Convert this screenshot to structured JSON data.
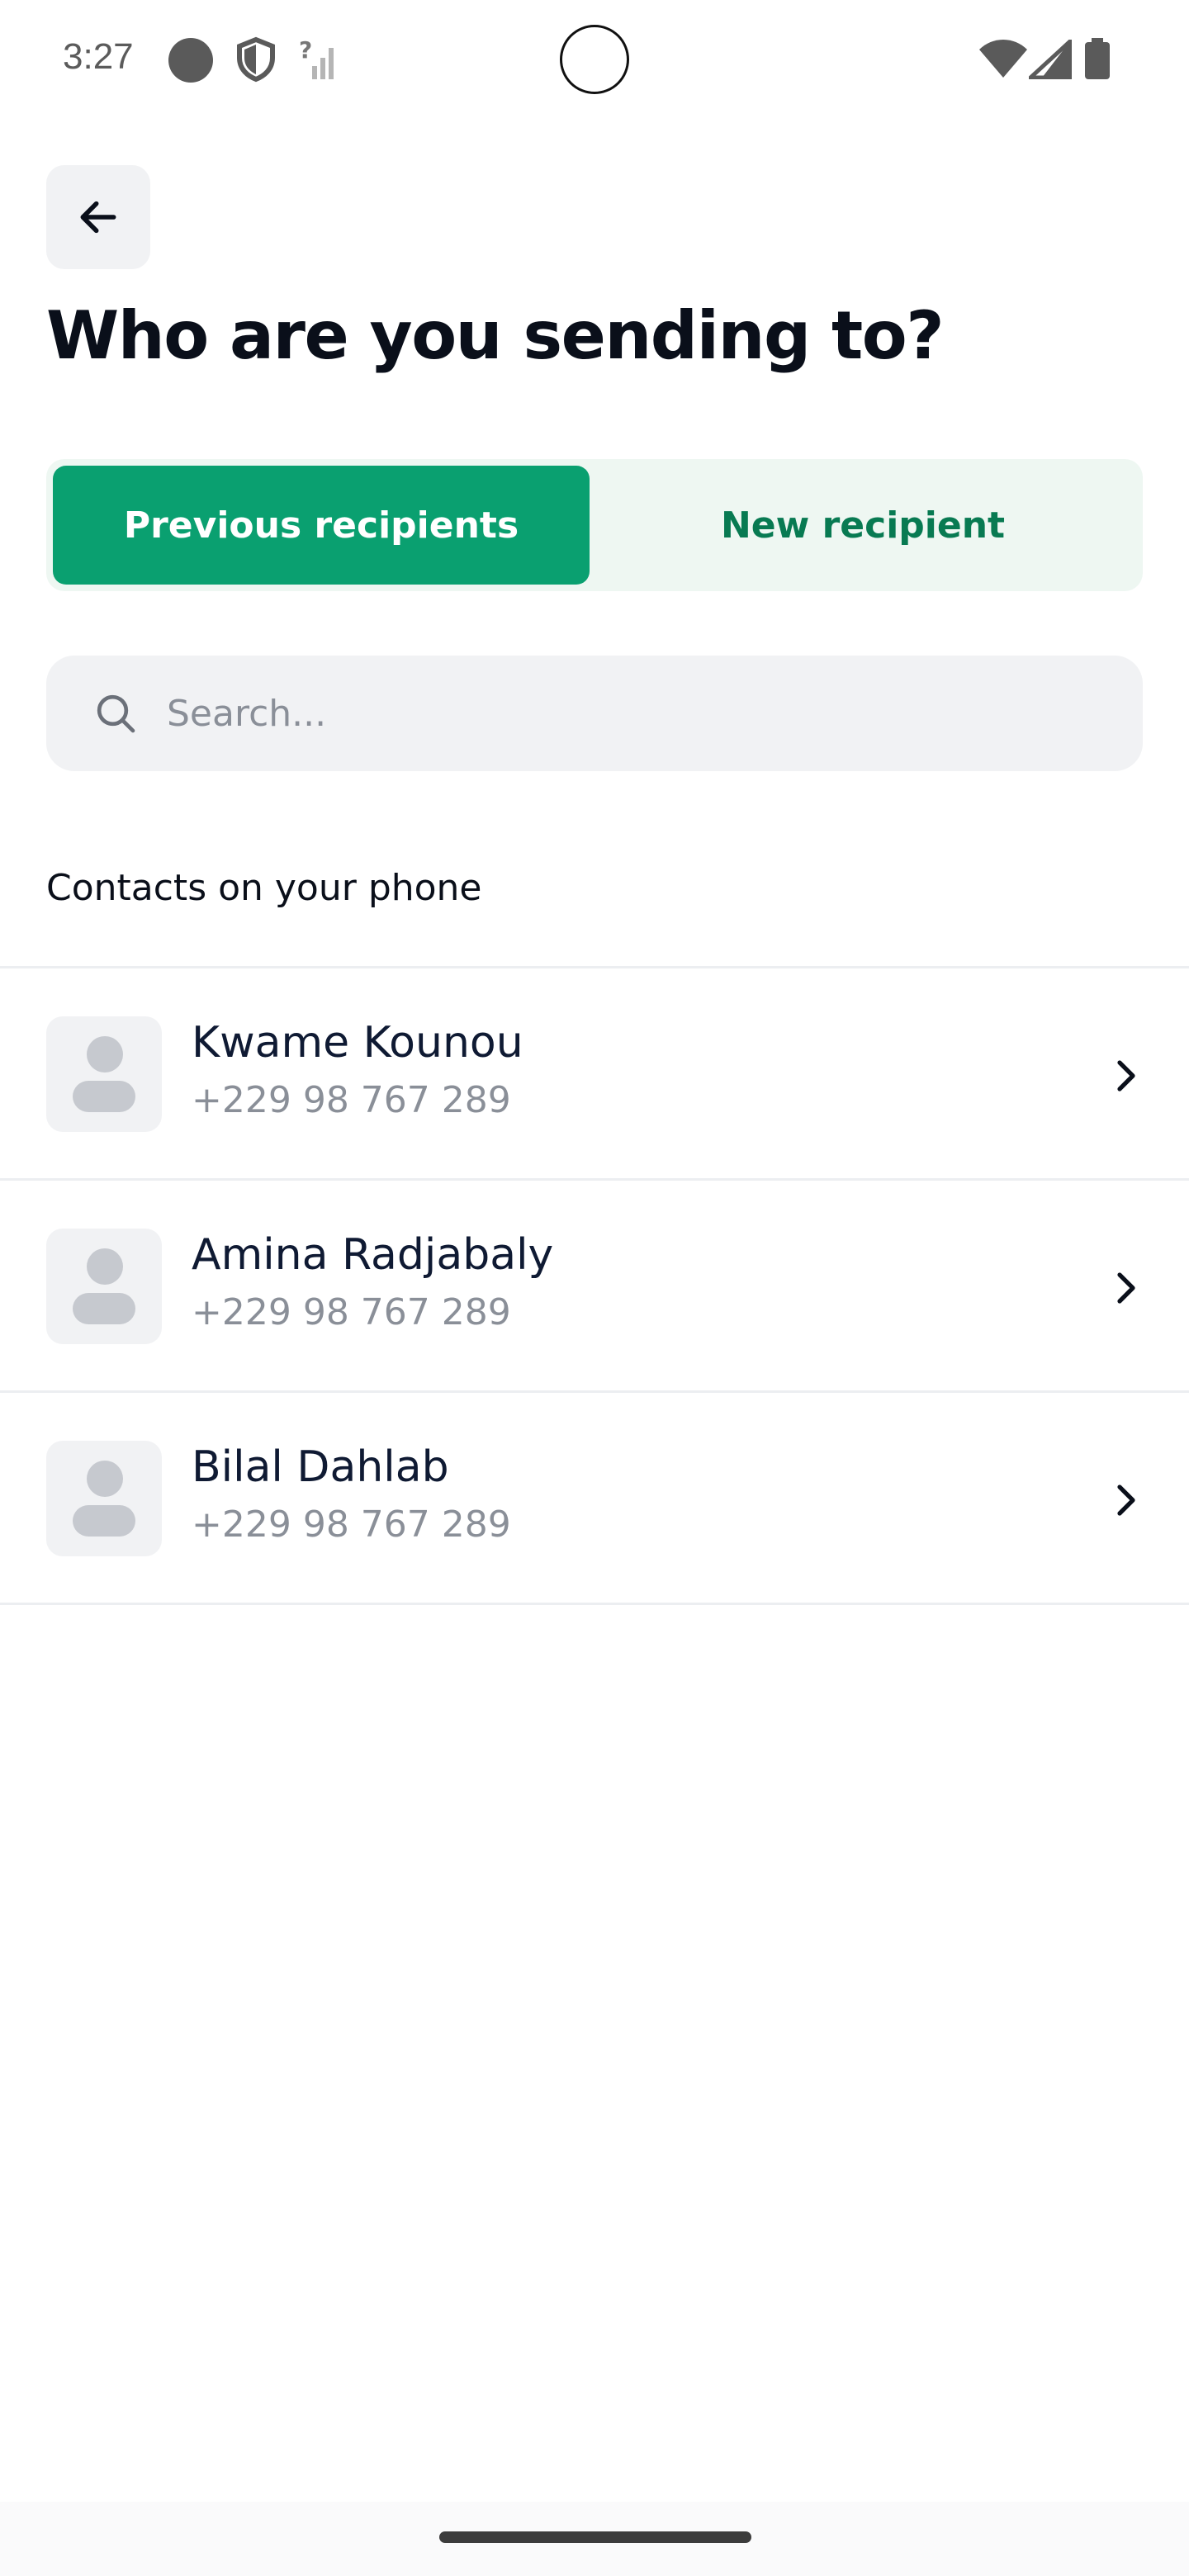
{
  "status_bar": {
    "time": "3:27",
    "icons": [
      "record-dot-icon",
      "shield-icon",
      "no-signal-icon",
      "wifi-icon",
      "cell-signal-icon",
      "battery-icon"
    ]
  },
  "header": {
    "back_icon": "arrow-left-icon",
    "title": "Who are you sending to?"
  },
  "tabs": [
    {
      "label": "Previous recipients",
      "active": true
    },
    {
      "label": "New recipient",
      "active": false
    }
  ],
  "search": {
    "placeholder": "Search...",
    "value": ""
  },
  "contacts_section": {
    "label": "Contacts on your phone",
    "items": [
      {
        "name": "Kwame Kounou",
        "phone": "+229 98 767 289"
      },
      {
        "name": "Amina Radjabaly",
        "phone": "+229 98 767 289"
      },
      {
        "name": "Bilal Dahlab",
        "phone": "+229 98 767 289"
      }
    ]
  },
  "colors": {
    "accent": "#0aa070",
    "accent_text": "#087a52",
    "tab_bg": "#eef7f2",
    "muted": "#8a8f98"
  }
}
